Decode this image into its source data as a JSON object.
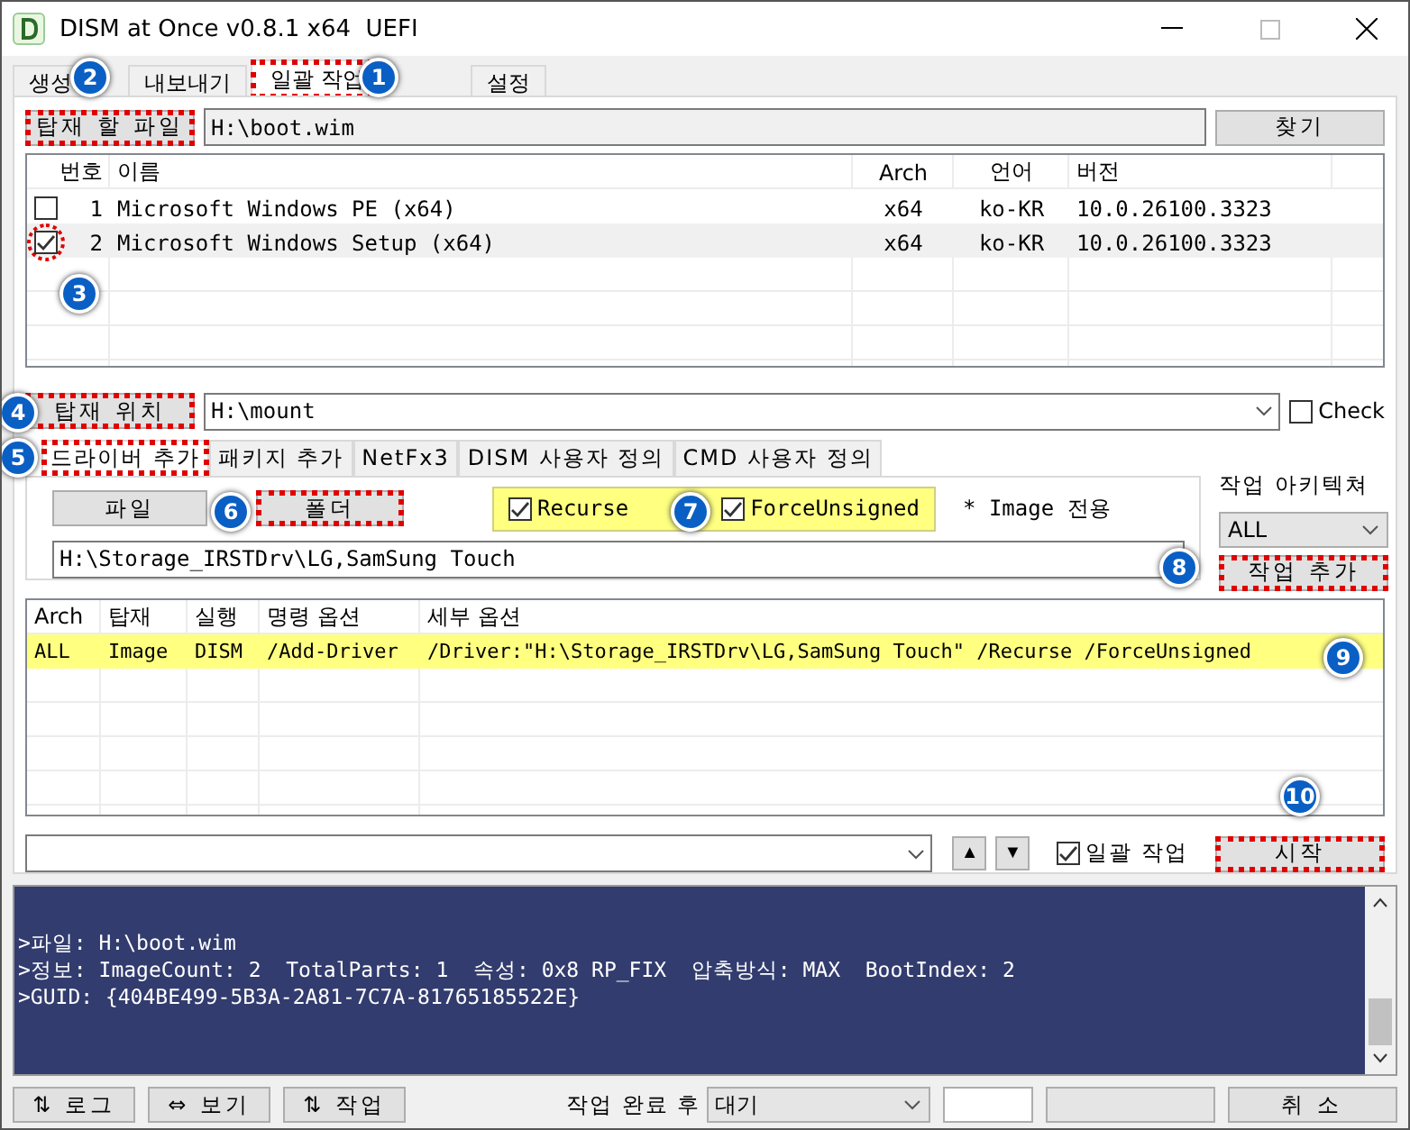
{
  "window": {
    "title": "DISM at Once v0.8.1 x64  UEFI"
  },
  "tabs": [
    {
      "label": "생성",
      "selected": false
    },
    {
      "label": "내보내기",
      "selected": false
    },
    {
      "label": "일괄 작업",
      "selected": true,
      "highlighted": true
    },
    {
      "label": "설정",
      "selected": false
    }
  ],
  "image_file": {
    "button": "탑재 할 파일",
    "highlighted": true,
    "value": "H:\\boot.wim",
    "browse": "찾기"
  },
  "image_table": {
    "columns": [
      "번호",
      "이름",
      "Arch",
      "언어",
      "버전"
    ],
    "rows": [
      {
        "checked": false,
        "selected": false,
        "highlighted": false,
        "cells": [
          "1",
          "Microsoft Windows PE (x64)",
          "x64",
          "ko-KR",
          "10.0.26100.3323"
        ]
      },
      {
        "checked": true,
        "selected": true,
        "highlighted": true,
        "cells": [
          "2",
          "Microsoft Windows Setup (x64)",
          "x64",
          "ko-KR",
          "10.0.26100.3323"
        ]
      }
    ]
  },
  "mount": {
    "button": "탑재 위치",
    "highlighted": true,
    "value": "H:\\mount",
    "check": {
      "label": "Check",
      "checked": false
    }
  },
  "sub_tabs": [
    {
      "label": "드라이버 추가",
      "selected": true,
      "highlighted": true
    },
    {
      "label": "패키지 추가",
      "selected": false
    },
    {
      "label": "NetFx3",
      "selected": false
    },
    {
      "label": "DISM 사용자 정의",
      "selected": false
    },
    {
      "label": "CMD 사용자 정의",
      "selected": false
    }
  ],
  "driver": {
    "buttons": [
      {
        "label": "파일",
        "highlighted": false
      },
      {
        "label": "폴더",
        "highlighted": true
      }
    ],
    "options": [
      {
        "label": "Recurse",
        "checked": true
      },
      {
        "label": "ForceUnsigned",
        "checked": true
      }
    ],
    "note": "* Image 전용",
    "path": "H:\\Storage_IRSTDrv\\LG,SamSung Touch"
  },
  "architecture": {
    "label": "작업 아키텍쳐",
    "value": "ALL",
    "add_button": "작업 추가",
    "highlighted": true
  },
  "task_table": {
    "columns": [
      "Arch",
      "탑재",
      "실행",
      "명령 옵션",
      "세부 옵션"
    ],
    "rows": [
      {
        "selected": true,
        "cells": [
          "ALL",
          "Image",
          "DISM",
          "/Add-Driver",
          "/Driver:\"H:\\Storage_IRSTDrv\\LG,SamSung Touch\" /Recurse /ForceUnsigned"
        ]
      }
    ]
  },
  "batch": {
    "up": "▲",
    "down": "▼",
    "checkbox": {
      "label": "일괄 작업",
      "checked": true
    },
    "start": "시작",
    "highlighted": true
  },
  "log": [
    ">파일: H:\\boot.wim",
    ">정보: ImageCount: 2  TotalParts: 1  속성: 0x8 RP_FIX  압축방식: MAX  BootIndex: 2",
    ">GUID: {404BE499-5B3A-2A81-7C7A-81765185522E}"
  ],
  "footer": {
    "buttons": [
      "⇅ 로그",
      "⇔ 보기",
      "⇅ 작업"
    ],
    "after_label": "작업 완료 후",
    "after_value": "대기",
    "cancel": "취 소"
  },
  "callouts": [
    "1",
    "2",
    "3",
    "4",
    "5",
    "6",
    "7",
    "8",
    "9",
    "10"
  ]
}
